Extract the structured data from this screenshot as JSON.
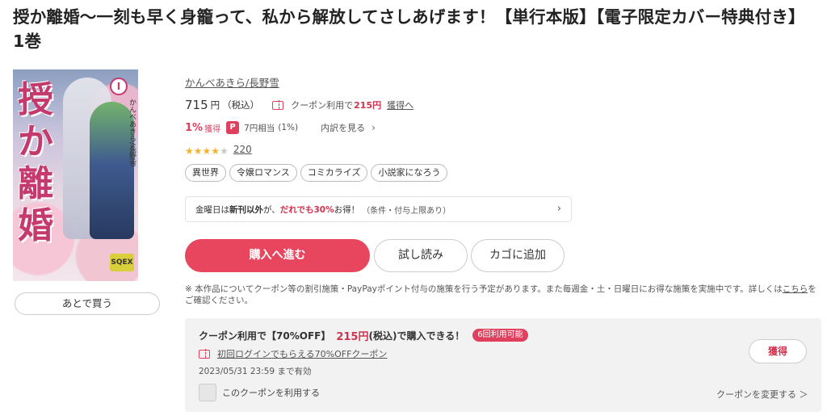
{
  "title": "授か離婚～一刻も早く身籠って、私から解放してさしあげます！【単行本版】【電子限定カバー特典付き】　1巻",
  "cover": {
    "title_art": "授か離婚",
    "volume": "I",
    "publisher_mark": "SQEX"
  },
  "later_button": "あとで買う",
  "author": "かんべあきら/長野雪",
  "price": {
    "amount": "715",
    "unit": "円",
    "tax": "（税込）",
    "coupon_label": "クーポン利用で",
    "coupon_price": "215円",
    "coupon_get": "獲得へ"
  },
  "points": {
    "percent": "1%",
    "get": "獲得",
    "icon": "P",
    "equiv": "7円相当",
    "rate": "(1%)",
    "breakdown": "内訳を見る"
  },
  "rating": {
    "stars": 4,
    "max": 5,
    "count": "220"
  },
  "tags": [
    "異世界",
    "令嬢ロマンス",
    "コミカライズ",
    "小説家になろう"
  ],
  "promo": {
    "part1": "金曜日は",
    "part2": "新刊以外",
    "part3": "が、",
    "part4": "だれでも30%",
    "part5": "お得！",
    "note": "（条件・付与上限あり）"
  },
  "buttons": {
    "buy": "購入へ進む",
    "trial": "試し読み",
    "cart": "カゴに追加"
  },
  "notice": {
    "text": "※ 本作品についてクーポン等の割引施策・PayPayポイント付与の施策を行う予定があります。また毎週金・土・日曜日にお得な施策を実施中です。詳しくは",
    "link": "こちら",
    "tail": "をご確認ください。"
  },
  "coupon_box": {
    "line1_a": "クーポン利用で",
    "line1_b": "【70%OFF】",
    "price": "215円",
    "line1_c": "(税込)で購入できる！",
    "badge": "6回利用可能",
    "link": "初回ログインでもらえる70%OFFクーポン",
    "expiry": "2023/05/31 23:59 まで有効",
    "checkbox_label": "このクーポンを利用する",
    "get_button": "獲得",
    "change": "クーポンを変更する ＞"
  },
  "colors": {
    "accent": "#e8465e",
    "accent_text": "#d0334f",
    "star": "#f0b52d"
  }
}
